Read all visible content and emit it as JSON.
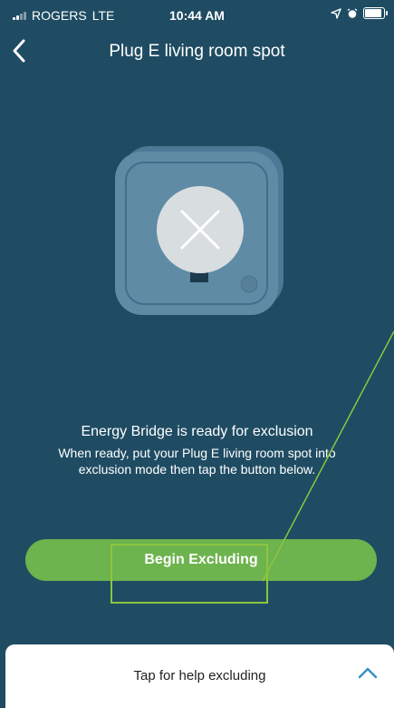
{
  "status_bar": {
    "carrier": "ROGERS",
    "network": "LTE",
    "time": "10:44 AM"
  },
  "header": {
    "title": "Plug E living room spot",
    "back_icon": "chevron-left-icon"
  },
  "device_illustration": {
    "state_icon": "close-x-icon",
    "colors": {
      "body": "#5f8ba5",
      "badge": "#d8dde0"
    }
  },
  "main": {
    "ready_message": "Energy Bridge is ready for exclusion",
    "instructions": "When ready, put your Plug E living room spot  into exclusion mode then tap the button below."
  },
  "primary_action": {
    "label": "Begin Excluding"
  },
  "help_sheet": {
    "label": "Tap for help excluding",
    "icon": "chevron-up-icon"
  },
  "colors": {
    "background": "#1f4c63",
    "accent": "#6db34e",
    "annotation": "#8cc63f"
  }
}
